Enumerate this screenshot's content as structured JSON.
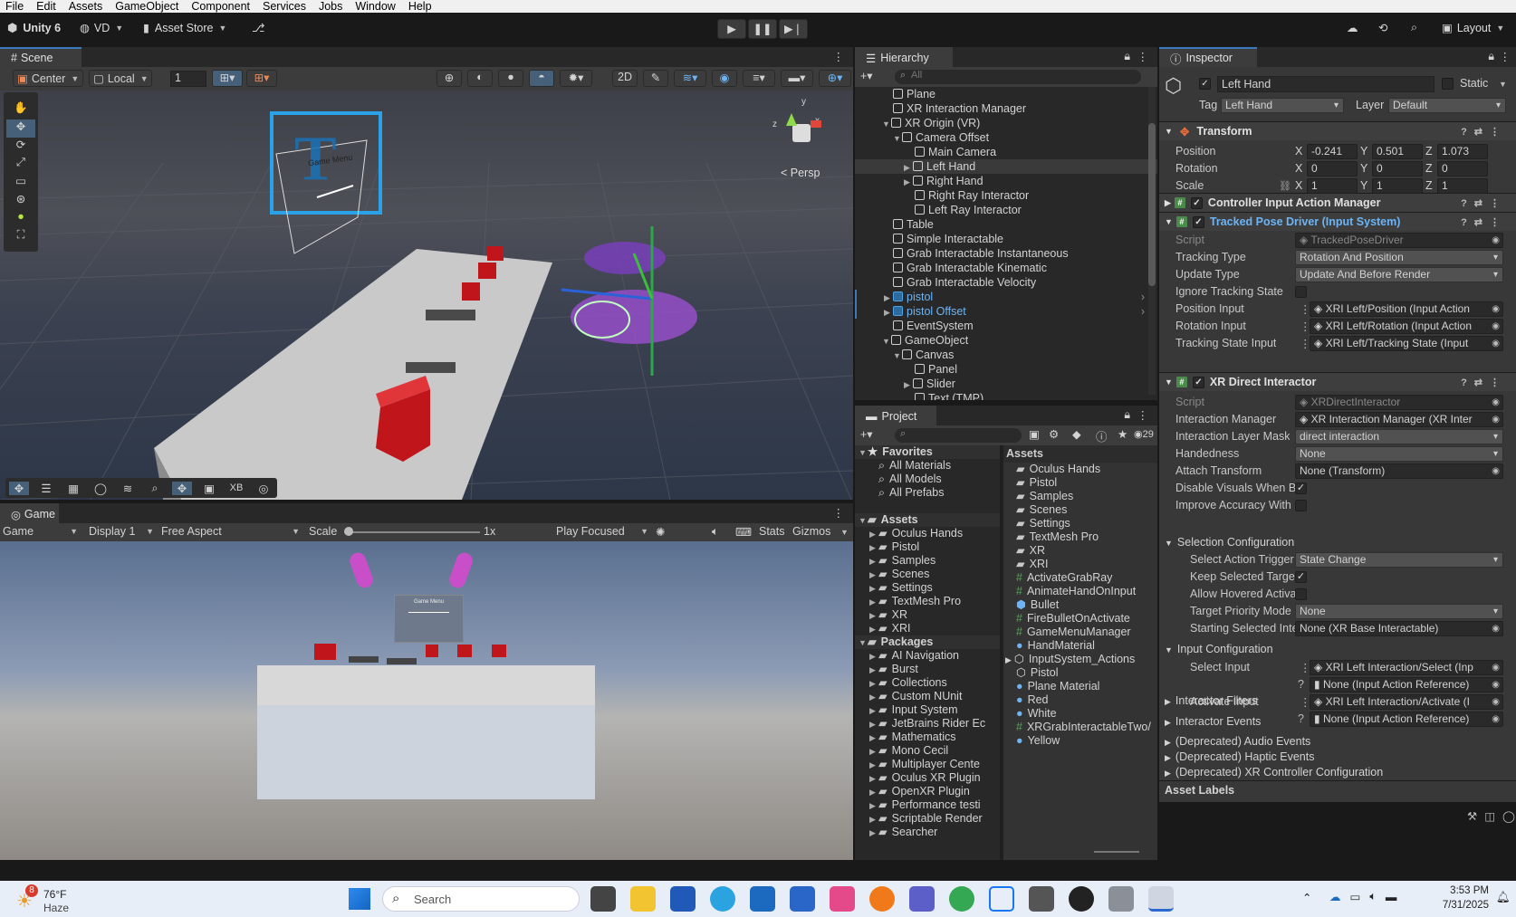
{
  "menu": [
    "File",
    "Edit",
    "Assets",
    "GameObject",
    "Component",
    "Services",
    "Jobs",
    "Window",
    "Help"
  ],
  "toolbar": {
    "product": "Unity 6",
    "account": "VD",
    "asset_store": "Asset Store",
    "layout": "Layout"
  },
  "scene": {
    "tab": "Scene",
    "pivot": "Center",
    "space": "Local",
    "grid_value": "1",
    "persp": "< Persp",
    "menu_text": "Game Menu",
    "overlay_xb": "XB",
    "gizmo_y": "y",
    "gizmo_x": "x",
    "gizmo_z": "z"
  },
  "game": {
    "tab": "Game",
    "mode": "Game",
    "display": "Display 1",
    "aspect": "Free Aspect",
    "scale_label": "Scale",
    "scale_value": "1x",
    "play_focused": "Play Focused",
    "stats": "Stats",
    "gizmos": "Gizmos",
    "menu_text": "Game Menu"
  },
  "hierarchy": {
    "tab": "Hierarchy",
    "search": "All",
    "items": [
      {
        "label": "Plane",
        "depth": 0,
        "arrow": ""
      },
      {
        "label": "XR Interaction Manager",
        "depth": 0,
        "arrow": ""
      },
      {
        "label": "XR Origin (VR)",
        "depth": 0,
        "arrow": "▼"
      },
      {
        "label": "Camera Offset",
        "depth": 1,
        "arrow": "▼"
      },
      {
        "label": "Main Camera",
        "depth": 2,
        "arrow": ""
      },
      {
        "label": "Left Hand",
        "depth": 2,
        "arrow": "▶"
      },
      {
        "label": "Right Hand",
        "depth": 2,
        "arrow": "▶"
      },
      {
        "label": "Right Ray Interactor",
        "depth": 2,
        "arrow": ""
      },
      {
        "label": "Left Ray Interactor",
        "depth": 2,
        "arrow": ""
      },
      {
        "label": "Table",
        "depth": 0,
        "arrow": ""
      },
      {
        "label": "Simple Interactable",
        "depth": 0,
        "arrow": ""
      },
      {
        "label": "Grab Interactable Instantaneous",
        "depth": 0,
        "arrow": ""
      },
      {
        "label": "Grab Interactable Kinematic",
        "depth": 0,
        "arrow": ""
      },
      {
        "label": "Grab Interactable Velocity",
        "depth": 0,
        "arrow": ""
      },
      {
        "label": "pistol",
        "depth": 0,
        "arrow": "▶"
      },
      {
        "label": "pistol Offset",
        "depth": 0,
        "arrow": "▶"
      },
      {
        "label": "EventSystem",
        "depth": 0,
        "arrow": ""
      },
      {
        "label": "GameObject",
        "depth": 0,
        "arrow": "▼"
      },
      {
        "label": "Canvas",
        "depth": 1,
        "arrow": "▼"
      },
      {
        "label": "Panel",
        "depth": 2,
        "arrow": ""
      },
      {
        "label": "Slider",
        "depth": 2,
        "arrow": "▶"
      },
      {
        "label": "Text (TMP)",
        "depth": 2,
        "arrow": ""
      }
    ]
  },
  "project": {
    "tab": "Project",
    "count": "29",
    "left": [
      {
        "label": "Favorites",
        "depth": 0,
        "arrow": "▼",
        "icon": "star",
        "bold": true
      },
      {
        "label": "All Materials",
        "depth": 1,
        "arrow": "",
        "icon": "search"
      },
      {
        "label": "All Models",
        "depth": 1,
        "arrow": "",
        "icon": "search"
      },
      {
        "label": "All Prefabs",
        "depth": 1,
        "arrow": "",
        "icon": "search"
      },
      {
        "label": "",
        "depth": 0,
        "arrow": "",
        "icon": ""
      },
      {
        "label": "Assets",
        "depth": 0,
        "arrow": "▼",
        "icon": "folder",
        "bold": true
      },
      {
        "label": "Oculus Hands",
        "depth": 1,
        "arrow": "▶",
        "icon": "folder"
      },
      {
        "label": "Pistol",
        "depth": 1,
        "arrow": "▶",
        "icon": "folder"
      },
      {
        "label": "Samples",
        "depth": 1,
        "arrow": "▶",
        "icon": "folder"
      },
      {
        "label": "Scenes",
        "depth": 1,
        "arrow": "▶",
        "icon": "folder"
      },
      {
        "label": "Settings",
        "depth": 1,
        "arrow": "▶",
        "icon": "folder"
      },
      {
        "label": "TextMesh Pro",
        "depth": 1,
        "arrow": "▶",
        "icon": "folder"
      },
      {
        "label": "XR",
        "depth": 1,
        "arrow": "▶",
        "icon": "folder"
      },
      {
        "label": "XRI",
        "depth": 1,
        "arrow": "▶",
        "icon": "folder"
      },
      {
        "label": "Packages",
        "depth": 0,
        "arrow": "▼",
        "icon": "folder",
        "bold": true
      },
      {
        "label": "AI Navigation",
        "depth": 1,
        "arrow": "▶",
        "icon": "folder"
      },
      {
        "label": "Burst",
        "depth": 1,
        "arrow": "▶",
        "icon": "folder"
      },
      {
        "label": "Collections",
        "depth": 1,
        "arrow": "▶",
        "icon": "folder"
      },
      {
        "label": "Custom NUnit",
        "depth": 1,
        "arrow": "▶",
        "icon": "folder"
      },
      {
        "label": "Input System",
        "depth": 1,
        "arrow": "▶",
        "icon": "folder"
      },
      {
        "label": "JetBrains Rider Ec",
        "depth": 1,
        "arrow": "▶",
        "icon": "folder"
      },
      {
        "label": "Mathematics",
        "depth": 1,
        "arrow": "▶",
        "icon": "folder"
      },
      {
        "label": "Mono Cecil",
        "depth": 1,
        "arrow": "▶",
        "icon": "folder"
      },
      {
        "label": "Multiplayer Cente",
        "depth": 1,
        "arrow": "▶",
        "icon": "folder"
      },
      {
        "label": "Oculus XR Plugin",
        "depth": 1,
        "arrow": "▶",
        "icon": "folder"
      },
      {
        "label": "OpenXR Plugin",
        "depth": 1,
        "arrow": "▶",
        "icon": "folder"
      },
      {
        "label": "Performance testi",
        "depth": 1,
        "arrow": "▶",
        "icon": "folder"
      },
      {
        "label": "Scriptable Render",
        "depth": 1,
        "arrow": "▶",
        "icon": "folder"
      },
      {
        "label": "Searcher",
        "depth": 1,
        "arrow": "▶",
        "icon": "folder"
      }
    ],
    "assets_header": "Assets",
    "right": [
      {
        "label": "Oculus Hands",
        "icon": "folder"
      },
      {
        "label": "Pistol",
        "icon": "folder"
      },
      {
        "label": "Samples",
        "icon": "folder"
      },
      {
        "label": "Scenes",
        "icon": "folder"
      },
      {
        "label": "Settings",
        "icon": "folder"
      },
      {
        "label": "TextMesh Pro",
        "icon": "folder"
      },
      {
        "label": "XR",
        "icon": "folder"
      },
      {
        "label": "XRI",
        "icon": "folder"
      },
      {
        "label": "ActivateGrabRay",
        "icon": "script"
      },
      {
        "label": "AnimateHandOnInput",
        "icon": "script"
      },
      {
        "label": "Bullet",
        "icon": "prefab"
      },
      {
        "label": "FireBulletOnActivate",
        "icon": "script"
      },
      {
        "label": "GameMenuManager",
        "icon": "script"
      },
      {
        "label": "HandMaterial",
        "icon": "material"
      },
      {
        "label": "InputSystem_Actions",
        "icon": "input"
      },
      {
        "label": "Pistol",
        "icon": "model"
      },
      {
        "label": "Plane Material",
        "icon": "material"
      },
      {
        "label": "Red",
        "icon": "material"
      },
      {
        "label": "White",
        "icon": "material"
      },
      {
        "label": "XRGrabInteractableTwo/",
        "icon": "script"
      },
      {
        "label": "Yellow",
        "icon": "material"
      }
    ]
  },
  "inspector": {
    "tab": "Inspector",
    "name": "Left Hand",
    "static": "Static",
    "tag_label": "Tag",
    "tag": "Left Hand",
    "layer_label": "Layer",
    "layer": "Default",
    "transform": {
      "title": "Transform",
      "position_label": "Position",
      "position": {
        "x": "-0.241",
        "y": "0.501",
        "z": "1.073"
      },
      "rotation_label": "Rotation",
      "rotation": {
        "x": "0",
        "y": "0",
        "z": "0"
      },
      "scale_label": "Scale",
      "scale": {
        "x": "1",
        "y": "1",
        "z": "1"
      }
    },
    "axis": {
      "x": "X",
      "y": "Y",
      "z": "Z"
    },
    "controller_title": "Controller Input Action Manager",
    "tracked_title": "Tracked Pose Driver (Input System)",
    "tracked": [
      {
        "label": "Script",
        "value": "TrackedPoseDriver",
        "kind": "obj",
        "dim": true
      },
      {
        "label": "Tracking Type",
        "value": "Rotation And Position",
        "kind": "dd"
      },
      {
        "label": "Update Type",
        "value": "Update And Before Render",
        "kind": "dd"
      },
      {
        "label": "Ignore Tracking State",
        "value": "",
        "kind": "chk"
      },
      {
        "label": "Position Input",
        "value": "XRI Left/Position (Input Action",
        "kind": "obj"
      },
      {
        "label": "Rotation Input",
        "value": "XRI Left/Rotation (Input Action",
        "kind": "obj"
      },
      {
        "label": "Tracking State Input",
        "value": "XRI Left/Tracking State (Input",
        "kind": "obj"
      }
    ],
    "direct_title": "XR Direct Interactor",
    "direct": [
      {
        "label": "Script",
        "value": "XRDirectInteractor",
        "kind": "obj",
        "dim": true
      },
      {
        "label": "Interaction Manager",
        "value": "XR Interaction Manager (XR Inter",
        "kind": "obj"
      },
      {
        "label": "Interaction Layer Mask",
        "value": "direct interaction",
        "kind": "dd"
      },
      {
        "label": "Handedness",
        "value": "None",
        "kind": "dd"
      },
      {
        "label": "Attach Transform",
        "value": "None (Transform)",
        "kind": "obj"
      },
      {
        "label": "Disable Visuals When Blc",
        "value": "✓",
        "kind": "chk"
      },
      {
        "label": "Improve Accuracy With S",
        "value": "",
        "kind": "chk"
      }
    ],
    "selection_config": "Selection Configuration",
    "selection": [
      {
        "label": "Select Action Trigger",
        "value": "State Change",
        "kind": "dd"
      },
      {
        "label": "Keep Selected Target",
        "value": "✓",
        "kind": "chk"
      },
      {
        "label": "Allow Hovered Activat",
        "value": "",
        "kind": "chk"
      },
      {
        "label": "Target Priority Mode",
        "value": "None",
        "kind": "dd"
      },
      {
        "label": "Starting Selected Inte",
        "value": "None (XR Base Interactable)",
        "kind": "obj"
      }
    ],
    "input_config": "Input Configuration",
    "select_input_label": "Select Input",
    "select_input": "XRI Left Interaction/Select (Inp",
    "select_input_ref": "None (Input Action Reference)",
    "activate_input_label": "Activate Input",
    "activate_input": "XRI Left Interaction/Activate (I",
    "activate_input_ref": "None (Input Action Reference)",
    "collapsed": [
      "Interactor Filters",
      "Interactor Events",
      "(Deprecated) Audio Events",
      "(Deprecated) Haptic Events",
      "(Deprecated) XR Controller Configuration"
    ],
    "asset_labels": "Asset Labels"
  },
  "taskbar": {
    "weather_temp": "76°F",
    "weather_desc": "Haze",
    "badge": "8",
    "search": "Search",
    "time": "3:53 PM",
    "date": "7/31/2025"
  },
  "colors": {
    "accent": "#3a79bb",
    "selection": "#2c5d87",
    "prefab_blue": "#6cb4f5",
    "red_cube": "#c0161b",
    "hand_purple": "#9b4fd0"
  }
}
